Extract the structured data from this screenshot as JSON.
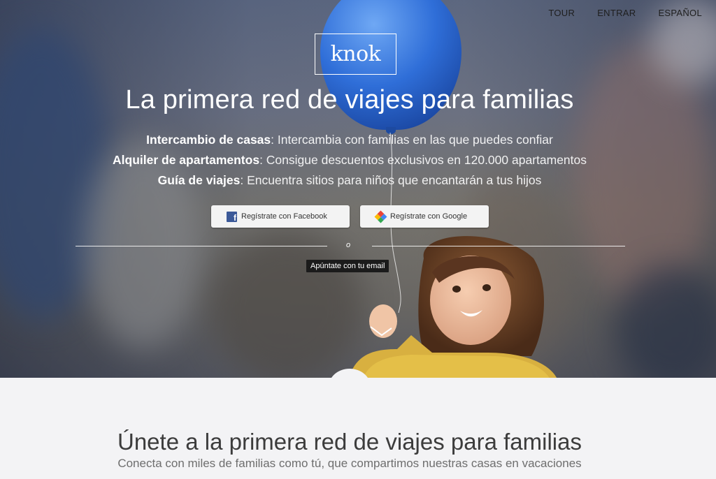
{
  "nav": {
    "tour": "TOUR",
    "login": "ENTRAR",
    "language": "ESPAÑOL"
  },
  "brand": {
    "logo_text": "knok"
  },
  "hero": {
    "headline": "La primera red de viajes para familias",
    "features": [
      {
        "title": "Intercambio de casas",
        "text": ": Intercambia con familias en las que puedes confiar"
      },
      {
        "title": "Alquiler de apartamentos",
        "text": ": Consigue descuentos exclusivos en 120.000 apartamentos"
      },
      {
        "title": "Guía de viajes",
        "text": ": Encuentra sitios para niños que encantarán a tus hijos"
      }
    ],
    "facebook_button": "Regístrate con Facebook",
    "google_button": "Regístrate con Google",
    "or_label": "o",
    "email_signup": "Apúntate con tu email"
  },
  "join": {
    "title": "Únete a la primera red de viajes para familias",
    "subtitle": "Conecta con miles de familias como tú, que compartimos nuestras casas en vacaciones"
  },
  "colors": {
    "facebook": "#3b5998",
    "balloon": "#2f6ed8",
    "section_bg": "#f3f3f5"
  }
}
